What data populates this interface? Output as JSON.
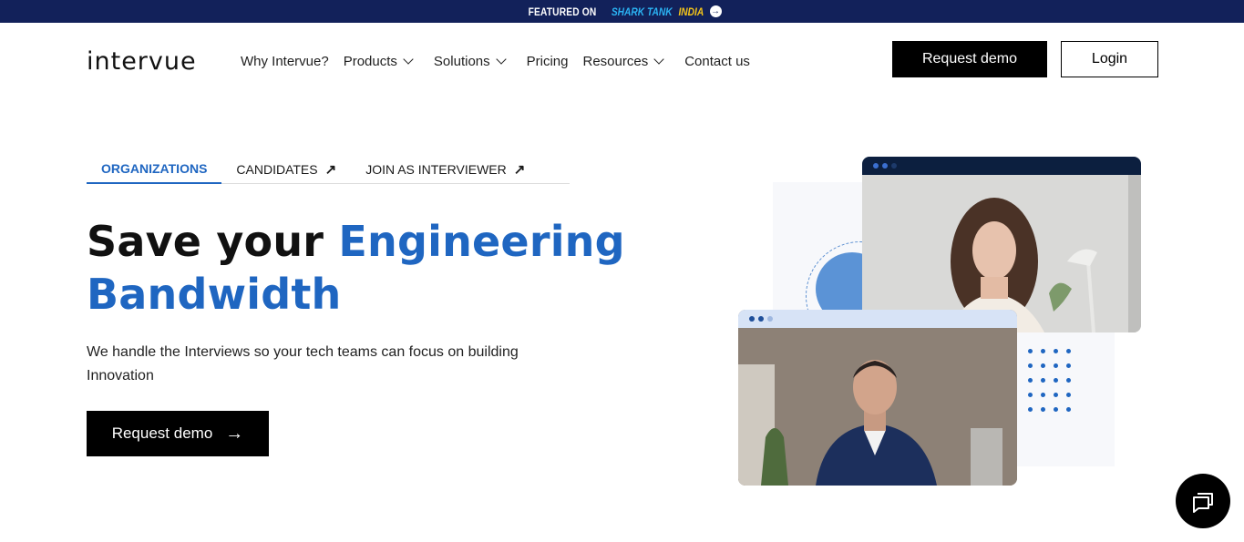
{
  "banner": {
    "featured": "FEATURED ON",
    "brand1": "SHARK TANK",
    "brand2": "INDIA"
  },
  "logo": {
    "text": "intervue"
  },
  "nav": {
    "items": [
      {
        "label": "Why Intervue?",
        "dropdown": false
      },
      {
        "label": "Products",
        "dropdown": true
      },
      {
        "label": "Solutions",
        "dropdown": true
      },
      {
        "label": "Pricing",
        "dropdown": false
      },
      {
        "label": "Resources",
        "dropdown": true
      },
      {
        "label": "Contact us",
        "dropdown": false
      }
    ],
    "request_demo": "Request demo",
    "login": "Login"
  },
  "tabs": [
    {
      "label": "ORGANIZATIONS",
      "active": true,
      "external": false
    },
    {
      "label": "CANDIDATES",
      "active": false,
      "external": true
    },
    {
      "label": "JOIN AS INTERVIEWER",
      "active": false,
      "external": true
    }
  ],
  "hero": {
    "title_plain": "Save your ",
    "title_accent_1": "Engineering",
    "title_accent_2": "Bandwidth",
    "subtitle": "We handle the Interviews so your tech teams can focus on building Innovation",
    "cta": "Request demo"
  },
  "colors": {
    "accent": "#1f66c1",
    "banner_bg": "#12215a",
    "dark": "#000000"
  },
  "icons": {
    "arrow_right": "arrow-right-icon",
    "external": "external-arrow-icon",
    "chat": "chat-icon"
  }
}
